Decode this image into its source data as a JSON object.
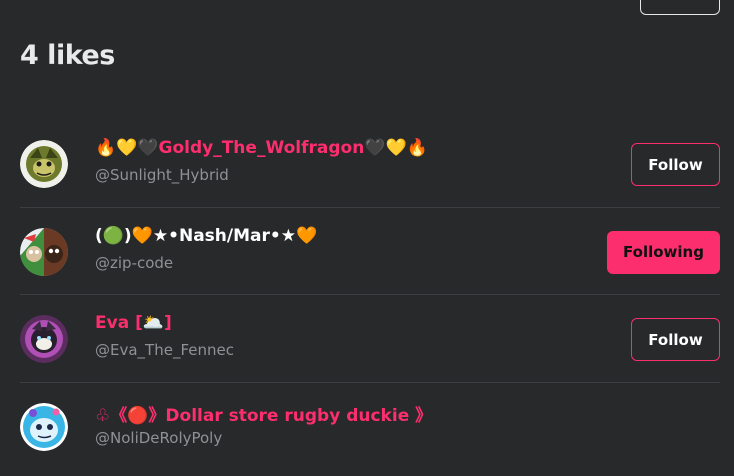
{
  "header": {
    "title": "4 likes"
  },
  "users": [
    {
      "name": "🔥💛🖤Goldy_The_Wolfragon🖤💛🔥",
      "handle": "@Sunlight_Hybrid",
      "button": "Follow",
      "following": false,
      "name_color": "pink"
    },
    {
      "name": "(🟢)🧡★•Nash/Mar•★🧡",
      "handle": "@zip-code",
      "button": "Following",
      "following": true,
      "name_color": "white"
    },
    {
      "name": "Eva [🌥️]",
      "handle": "@Eva_The_Fennec",
      "button": "Follow",
      "following": false,
      "name_color": "pink"
    },
    {
      "name": "♧《🔴》Dollar store rugby duckie 》",
      "handle": "@NoliDeRolyPoly",
      "button": "",
      "following": false,
      "name_color": "pink"
    }
  ],
  "colors": {
    "accent": "#fd2e6e",
    "background": "#27292b",
    "muted": "#8f9194"
  }
}
